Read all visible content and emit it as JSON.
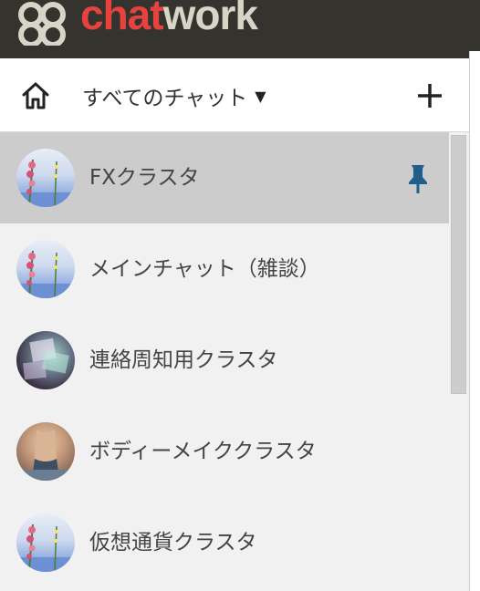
{
  "brand": {
    "name_part1": "chat",
    "name_part2": "work"
  },
  "header": {
    "home_icon": "home-icon",
    "filter_label": "すべてのチャット",
    "filter_caret": "▼",
    "add_icon": "plus-icon"
  },
  "rooms": [
    {
      "name": "FXクラスタ",
      "avatar": "flower-sky",
      "selected": true,
      "pinned": true
    },
    {
      "name": "メインチャット（雑談）",
      "avatar": "flower-sky",
      "selected": false,
      "pinned": false
    },
    {
      "name": "連絡周知用クラスタ",
      "avatar": "dark-abstract",
      "selected": false,
      "pinned": false
    },
    {
      "name": "ボディーメイククラスタ",
      "avatar": "fitness-photo",
      "selected": false,
      "pinned": false
    },
    {
      "name": "仮想通貨クラスタ",
      "avatar": "flower-sky",
      "selected": false,
      "pinned": false
    }
  ],
  "colors": {
    "topbar": "#34332e",
    "brand_red": "#e8423f",
    "brand_beige": "#d9d4c8",
    "selected_row": "#cccccc",
    "list_bg": "#f1f1f1",
    "pin_blue": "#1f5f8b"
  }
}
